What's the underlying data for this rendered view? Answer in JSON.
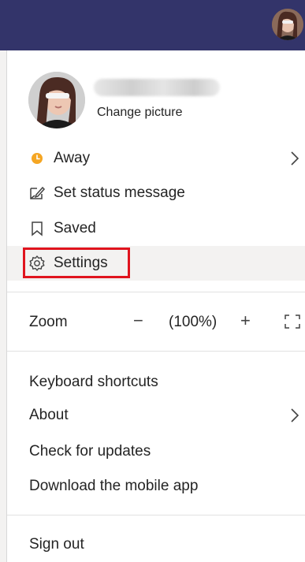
{
  "menu": {
    "profile": {
      "change_picture": "Change picture",
      "name_blurred": ""
    },
    "status": {
      "label": "Away",
      "color": "#f5a623"
    },
    "set_status_message": "Set status message",
    "saved": "Saved",
    "settings": "Settings",
    "zoom": {
      "label": "Zoom",
      "minus": "−",
      "value": "(100%)",
      "plus": "+"
    },
    "keyboard_shortcuts": "Keyboard shortcuts",
    "about": "About",
    "check_updates": "Check for updates",
    "download_mobile": "Download the mobile app",
    "sign_out": "Sign out"
  },
  "colors": {
    "header": "#33346a",
    "highlight_border": "#e0141e",
    "away": "#f5a623"
  },
  "icons": [
    "avatar",
    "away-status-icon",
    "edit-status-icon",
    "bookmark-icon",
    "gear-icon",
    "chevron-right-icon",
    "fullscreen-icon"
  ]
}
